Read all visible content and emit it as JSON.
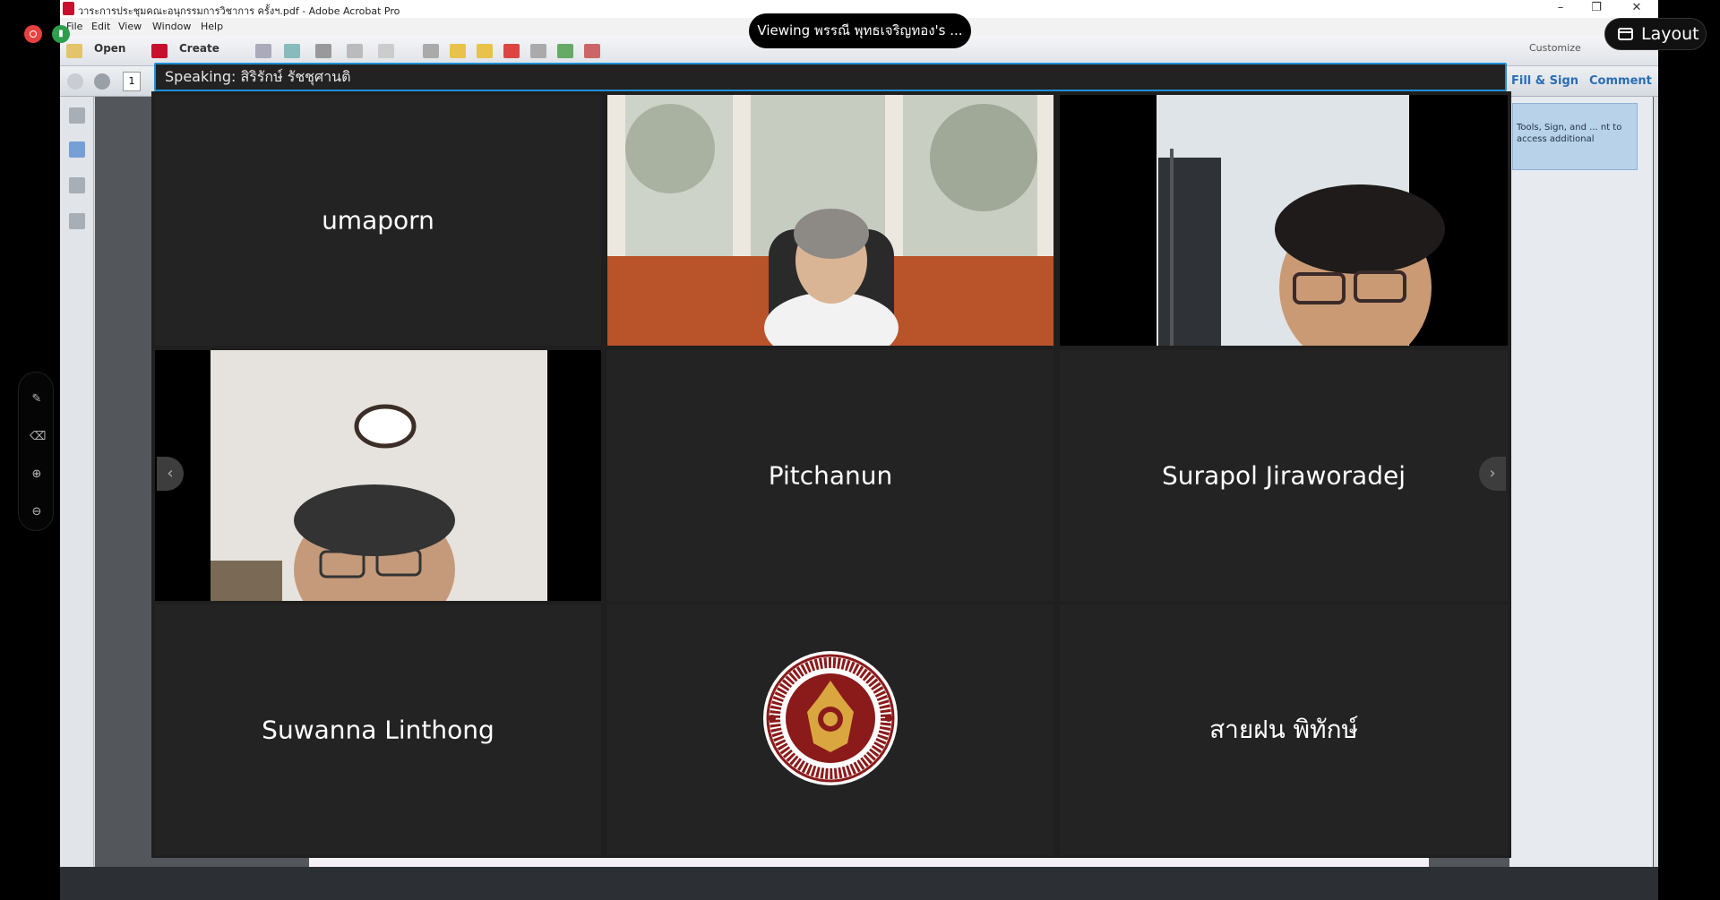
{
  "acrobat": {
    "title": "วาระการประชุมคณะอนุกรรมการวิชาการ ครั้งฯ.pdf - Adobe Acrobat Pro",
    "menu": [
      "File",
      "Edit",
      "View",
      "Window",
      "Help"
    ],
    "open_label": "Open",
    "create_label": "Create",
    "customize_label": "Customize",
    "page_number": "1",
    "fill_sign_label": "Fill & Sign",
    "comment_label": "Comment",
    "tip_text": "Tools, Sign, and ... nt to access additional"
  },
  "zoom": {
    "viewing_text": "Viewing พรรณี พุทธเจริญทอง's ...",
    "layout_label": "Layout",
    "speaking_text": "Speaking: สิริรักษ์ รัชชุศานติ",
    "prev_arrow": "‹",
    "next_arrow": "›",
    "participants": [
      {
        "name": "umaporn",
        "video": false
      },
      {
        "name": "",
        "video": true
      },
      {
        "name": "",
        "video": true
      },
      {
        "name": "",
        "video": true
      },
      {
        "name": "Pitchanun",
        "video": false
      },
      {
        "name": "Surapol Jiraworadej",
        "video": false
      },
      {
        "name": "Suwanna Linthong",
        "video": false
      },
      {
        "name": "",
        "logo": true
      },
      {
        "name": "สายฝน พิทักษ์",
        "video": false
      }
    ]
  },
  "colors": {
    "speaking_border": "#1f8fd6",
    "tile_bg": "#232323",
    "logo_red": "#8b1a1a",
    "logo_gold": "#d9a640"
  }
}
